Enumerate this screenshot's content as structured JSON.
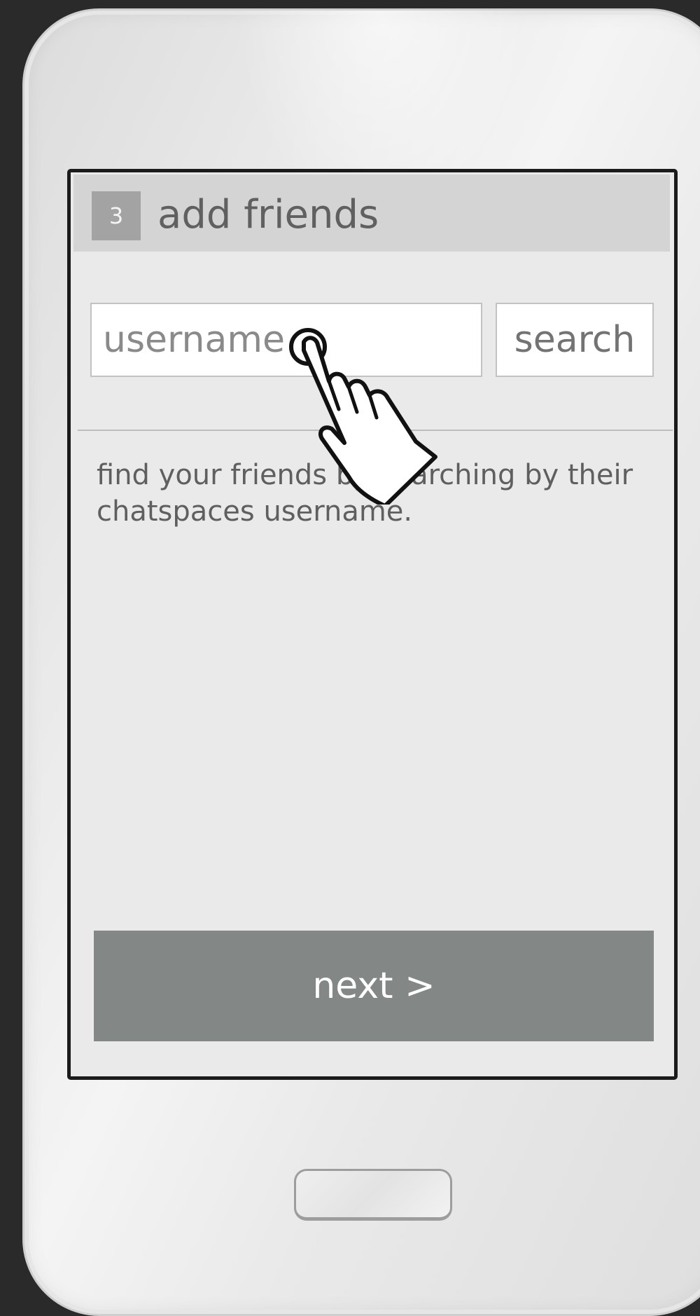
{
  "header": {
    "step": "3",
    "title": "add friends"
  },
  "search": {
    "placeholder": "username",
    "button_label": "search"
  },
  "help_text": "find your friends by searching by their chatspaces username.",
  "footer": {
    "next_label": "next >"
  },
  "colors": {
    "header_bg": "#d4d4d4",
    "screen_bg": "#eaeaea",
    "next_button_bg": "#838886",
    "badge_bg": "#a3a3a3"
  },
  "icons": {
    "cursor": "tap-hand-icon",
    "home": "home-button-icon"
  }
}
